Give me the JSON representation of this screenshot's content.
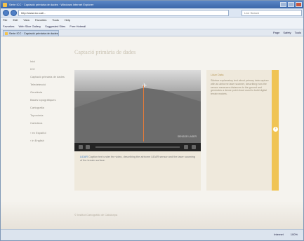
{
  "window": {
    "title": "Serie ICC · Captació primària de dades · Windows Internet Explorer",
    "controls": [
      "–",
      "□",
      "×"
    ]
  },
  "addressbar": {
    "url": "http://www.icc.cat/...",
    "search_placeholder": "Live Search"
  },
  "menubar": [
    "File",
    "Edit",
    "View",
    "Favorites",
    "Tools",
    "Help"
  ],
  "favorites": [
    "Favorites",
    "Web Slice Gallery",
    "Suggested Sites",
    "Free Hotmail"
  ],
  "tab": {
    "label": "Serie ICC · Captació primària de dades"
  },
  "commandbar": [
    "Page",
    "Safety",
    "Tools"
  ],
  "page": {
    "title": "Captació primària de dades",
    "nav": [
      "Inici",
      "ICC",
      "Captació primària de dades",
      "Teledetecció",
      "Geodèsia",
      "Bases topogràfiques",
      "Cartografia",
      "Toponímia",
      "Cartoteca"
    ],
    "languages": [
      "› en Español",
      "› in English"
    ],
    "video": {
      "overlay_label": "SENSOR LASER",
      "progress_percent": 0
    },
    "caption": "Caption text under the video, describing the airborne LiDAR sensor and the laser scanning of the terrain surface.",
    "caption_link": "LiDAR",
    "sidebar": {
      "heading": "Lidar Data",
      "text": "Sidebar explanatory text about primary data capture with an airborne laser scanner, describing how the sensor measures distances to the ground and generates a dense point cloud used to build digital terrain models."
    },
    "footer": "© Institut Cartogràfic de Catalunya"
  },
  "statusbar": {
    "zone": "Internet",
    "zoom": "100%"
  }
}
